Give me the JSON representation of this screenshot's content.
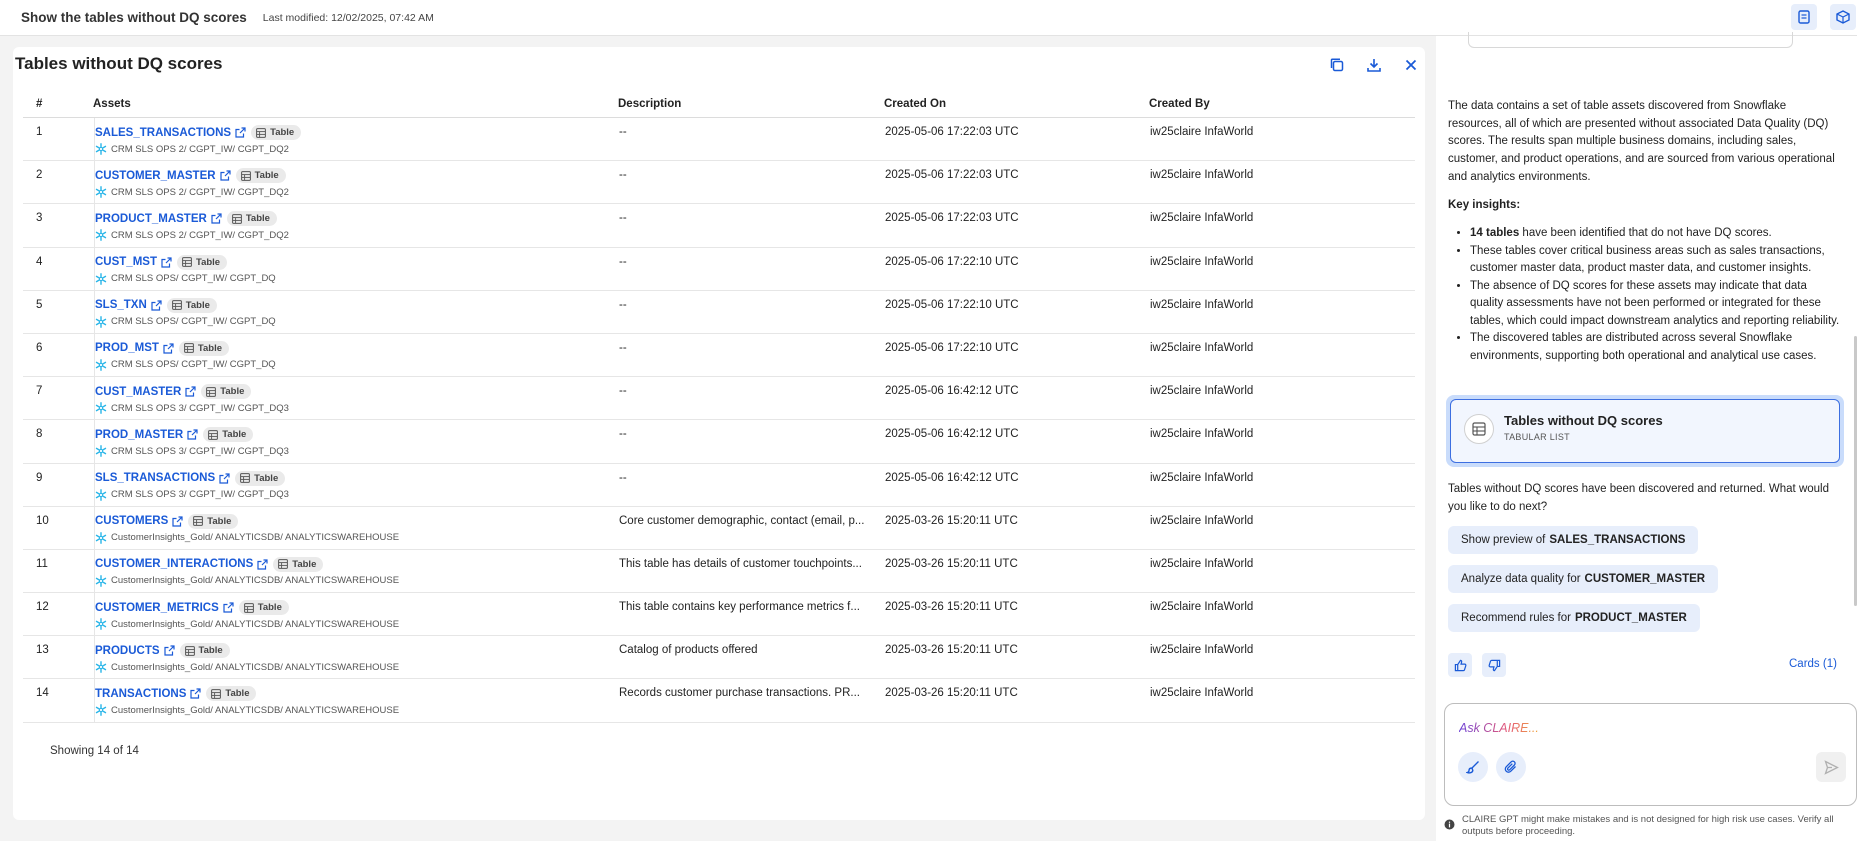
{
  "topbar": {
    "title": "Show the tables without DQ scores",
    "modified": "Last modified: 12/02/2025, 07:42 AM",
    "icons": [
      "document-icon",
      "cube-icon"
    ]
  },
  "panel": {
    "title": "Tables without DQ scores",
    "actions": [
      "copy-icon",
      "download-icon",
      "close-icon"
    ]
  },
  "table": {
    "columns": {
      "num": "#",
      "assets": "Assets",
      "description": "Description",
      "created_on": "Created On",
      "created_by": "Created By"
    },
    "badge_label": "Table",
    "rows": [
      {
        "num": "1",
        "name": "SALES_TRANSACTIONS",
        "path": "CRM SLS OPS 2/ CGPT_IW/ CGPT_DQ2",
        "description": "--",
        "created_on": "2025-05-06 17:22:03 UTC",
        "created_by": "iw25claire InfaWorld"
      },
      {
        "num": "2",
        "name": "CUSTOMER_MASTER",
        "path": "CRM SLS OPS 2/ CGPT_IW/ CGPT_DQ2",
        "description": "--",
        "created_on": "2025-05-06 17:22:03 UTC",
        "created_by": "iw25claire InfaWorld"
      },
      {
        "num": "3",
        "name": "PRODUCT_MASTER",
        "path": "CRM SLS OPS 2/ CGPT_IW/ CGPT_DQ2",
        "description": "--",
        "created_on": "2025-05-06 17:22:03 UTC",
        "created_by": "iw25claire InfaWorld"
      },
      {
        "num": "4",
        "name": "CUST_MST",
        "path": "CRM SLS OPS/ CGPT_IW/ CGPT_DQ",
        "description": "--",
        "created_on": "2025-05-06 17:22:10 UTC",
        "created_by": "iw25claire InfaWorld"
      },
      {
        "num": "5",
        "name": "SLS_TXN",
        "path": "CRM SLS OPS/ CGPT_IW/ CGPT_DQ",
        "description": "--",
        "created_on": "2025-05-06 17:22:10 UTC",
        "created_by": "iw25claire InfaWorld"
      },
      {
        "num": "6",
        "name": "PROD_MST",
        "path": "CRM SLS OPS/ CGPT_IW/ CGPT_DQ",
        "description": "--",
        "created_on": "2025-05-06 17:22:10 UTC",
        "created_by": "iw25claire InfaWorld"
      },
      {
        "num": "7",
        "name": "CUST_MASTER",
        "path": "CRM SLS OPS 3/ CGPT_IW/ CGPT_DQ3",
        "description": "--",
        "created_on": "2025-05-06 16:42:12 UTC",
        "created_by": "iw25claire InfaWorld"
      },
      {
        "num": "8",
        "name": "PROD_MASTER",
        "path": "CRM SLS OPS 3/ CGPT_IW/ CGPT_DQ3",
        "description": "--",
        "created_on": "2025-05-06 16:42:12 UTC",
        "created_by": "iw25claire InfaWorld"
      },
      {
        "num": "9",
        "name": "SLS_TRANSACTIONS",
        "path": "CRM SLS OPS 3/ CGPT_IW/ CGPT_DQ3",
        "description": "--",
        "created_on": "2025-05-06 16:42:12 UTC",
        "created_by": "iw25claire InfaWorld"
      },
      {
        "num": "10",
        "name": "CUSTOMERS",
        "path": "CustomerInsights_Gold/ ANALYTICSDB/ ANALYTICSWAREHOUSE",
        "description": "Core customer demographic, contact (email, p...",
        "created_on": "2025-03-26 15:20:11 UTC",
        "created_by": "iw25claire InfaWorld"
      },
      {
        "num": "11",
        "name": "CUSTOMER_INTERACTIONS",
        "path": "CustomerInsights_Gold/ ANALYTICSDB/ ANALYTICSWAREHOUSE",
        "description": "This table has details of customer touchpoints...",
        "created_on": "2025-03-26 15:20:11 UTC",
        "created_by": "iw25claire InfaWorld"
      },
      {
        "num": "12",
        "name": "CUSTOMER_METRICS",
        "path": "CustomerInsights_Gold/ ANALYTICSDB/ ANALYTICSWAREHOUSE",
        "description": "This table contains key performance metrics f...",
        "created_on": "2025-03-26 15:20:11 UTC",
        "created_by": "iw25claire InfaWorld"
      },
      {
        "num": "13",
        "name": "PRODUCTS",
        "path": "CustomerInsights_Gold/ ANALYTICSDB/ ANALYTICSWAREHOUSE",
        "description": "Catalog of products offered",
        "created_on": "2025-03-26 15:20:11 UTC",
        "created_by": "iw25claire InfaWorld"
      },
      {
        "num": "14",
        "name": "TRANSACTIONS",
        "path": "CustomerInsights_Gold/ ANALYTICSDB/ ANALYTICSWAREHOUSE",
        "description": "Records customer purchase transactions. PR...",
        "created_on": "2025-03-26 15:20:11 UTC",
        "created_by": "iw25claire InfaWorld"
      }
    ],
    "showing": "Showing 14 of 14"
  },
  "chat": {
    "summary": "The data contains a set of table assets discovered from Snowflake resources, all of which are presented without associated Data Quality (DQ) scores. The results span multiple business domains, including sales, customer, and product operations, and are sourced from various operational and analytics environments.",
    "insights_title": "Key insights:",
    "insight1_bold": "14 tables",
    "insight1_rest": " have been identified that do not have DQ scores.",
    "insight2": "These tables cover critical business areas such as sales transactions, customer master data, product master data, and customer insights.",
    "insight3": "The absence of DQ scores for these assets may indicate that data quality assessments have not been performed or integrated for these tables, which could impact downstream analytics and reporting reliability.",
    "insight4": "The discovered tables are distributed across several Snowflake environments, supporting both operational and analytical use cases.",
    "card_title": "Tables without DQ scores",
    "card_sub": "TABULAR LIST",
    "next": "Tables without DQ scores have been discovered and returned. What would you like to do next?",
    "suggestions": [
      {
        "prefix": "Show preview of",
        "target": "SALES_TRANSACTIONS"
      },
      {
        "prefix": "Analyze data quality for",
        "target": "CUSTOMER_MASTER"
      },
      {
        "prefix": "Recommend rules for",
        "target": "PRODUCT_MASTER"
      }
    ],
    "cards_link": "Cards (1)",
    "ask_placeholder": "Ask CLAIRE...",
    "disclaimer": "CLAIRE GPT might make mistakes and is not designed for high risk use cases. Verify all outputs before proceeding."
  },
  "colors": {
    "accent": "#1a5ad7",
    "card_border": "#3d6fe1",
    "snowflake": "#29b5e8"
  }
}
